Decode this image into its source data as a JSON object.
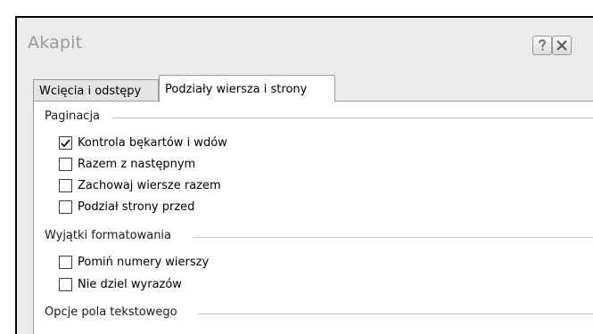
{
  "window": {
    "title": "Akapit",
    "help_icon": "question-mark-icon",
    "close_icon": "close-x-icon"
  },
  "tabs": [
    {
      "label": "Wcięcia i odstępy",
      "active": false
    },
    {
      "label": "Podziały wiersza i strony",
      "active": true
    }
  ],
  "groups": {
    "pagination": {
      "label": "Paginacja",
      "items": [
        {
          "label": "Kontrola bękartów i wdów",
          "checked": true
        },
        {
          "label": "Razem z następnym",
          "checked": false
        },
        {
          "label": "Zachowaj wiersze razem",
          "checked": false
        },
        {
          "label": "Podział strony przed",
          "checked": false
        }
      ]
    },
    "formatting_exceptions": {
      "label": "Wyjątki formatowania",
      "items": [
        {
          "label": "Pomiń numery wierszy",
          "checked": false
        },
        {
          "label": "Nie dziel wyrazów",
          "checked": false
        }
      ]
    },
    "textbox_options": {
      "label": "Opcje pola tekstowego"
    }
  },
  "colors": {
    "title_text": "#9a9a9a",
    "window_bg": "#ebebeb",
    "panel_bg": "#ffffff",
    "border": "#9c9c9c"
  }
}
